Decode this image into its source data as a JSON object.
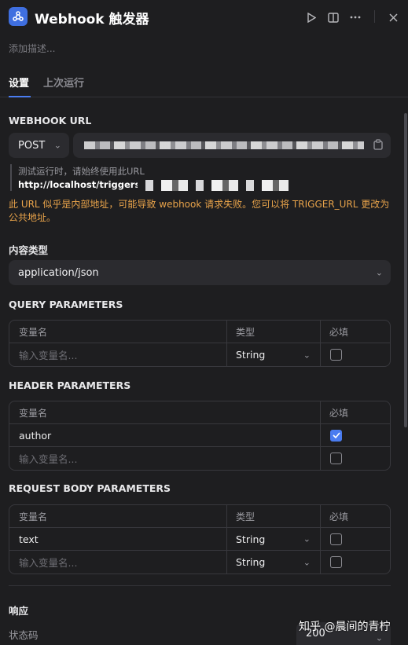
{
  "header": {
    "title": "Webhook 触发器",
    "description_placeholder": "添加描述..."
  },
  "tabs": [
    {
      "label": "设置",
      "active": true
    },
    {
      "label": "上次运行",
      "active": false
    }
  ],
  "webhook": {
    "section_title": "WEBHOOK URL",
    "method": "POST",
    "hint_text": "测试运行时，请始终使用此URL",
    "test_url_prefix": "http://localhost/triggers/w",
    "warning": "此 URL 似乎是内部地址，可能导致 webhook 请求失败。您可以将 TRIGGER_URL 更改为公共地址。"
  },
  "content_type": {
    "section_title": "内容类型",
    "value": "application/json"
  },
  "query_params": {
    "section_title": "QUERY PARAMETERS",
    "columns": [
      "变量名",
      "类型",
      "必填"
    ],
    "rows": [
      {
        "name_placeholder": "输入变量名...",
        "type": "String",
        "required": false
      }
    ]
  },
  "header_params": {
    "section_title": "HEADER PARAMETERS",
    "columns": [
      "变量名",
      "必填"
    ],
    "rows": [
      {
        "name": "author",
        "required": true
      },
      {
        "name_placeholder": "输入变量名...",
        "required": false
      }
    ]
  },
  "body_params": {
    "section_title": "REQUEST BODY PARAMETERS",
    "columns": [
      "变量名",
      "类型",
      "必填"
    ],
    "rows": [
      {
        "name": "text",
        "type": "String",
        "required": false
      },
      {
        "name_placeholder": "输入变量名...",
        "type": "String",
        "required": false
      }
    ]
  },
  "response": {
    "section_title": "响应",
    "status_label": "状态码",
    "status_value": "200"
  },
  "watermark": "知乎 @晨间的青柠",
  "colors": {
    "background": "#1e1e20",
    "accent": "#4a7cf0",
    "warning": "#e8a34a"
  }
}
